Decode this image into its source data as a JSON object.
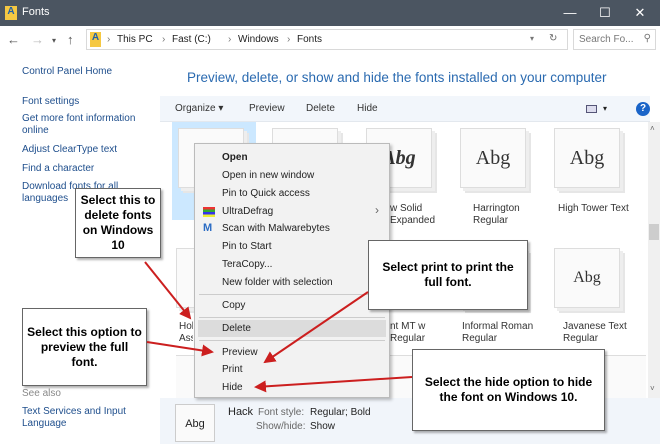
{
  "window": {
    "title": "Fonts",
    "minimize": "—",
    "maximize": "☐",
    "close": "✕"
  },
  "address": {
    "path": [
      "This PC",
      "Fast (C:)",
      "Windows",
      "Fonts"
    ],
    "search_placeholder": "Search Fo..."
  },
  "sidebar": {
    "links": [
      "Control Panel Home",
      "Font settings",
      "Get more font information online",
      "Adjust ClearType text",
      "Find a character",
      "Download fonts for all languages"
    ],
    "see_also": "See also",
    "see_also_links": [
      "Text Services and Input Language"
    ]
  },
  "heading": "Preview, delete, or show and hide the fonts installed on your computer",
  "toolbar": {
    "organize": "Organize ▾",
    "preview": "Preview",
    "delete": "Delete",
    "hide": "Hide",
    "help": "?"
  },
  "fonts": [
    {
      "sample": "",
      "name": ""
    },
    {
      "sample": "",
      "name": ""
    },
    {
      "sample": "Abg",
      "name": "w Solid Expanded"
    },
    {
      "sample": "Abg",
      "name": "Harrington Regular"
    },
    {
      "sample": "Abg",
      "name": "High Tower Text"
    },
    {
      "sample": "",
      "name": "Hol Ass"
    },
    {
      "sample": "",
      "name": "nt MT w Regular"
    },
    {
      "sample": "",
      "name": "Informal Roman Regular"
    },
    {
      "sample": "Abg",
      "name": "Javanese Text Regular"
    }
  ],
  "context_menu": [
    "Open",
    "Open in new window",
    "Pin to Quick access",
    "UltraDefrag",
    "Scan with Malwarebytes",
    "Pin to Start",
    "TeraCopy...",
    "New folder with selection",
    "Copy",
    "Delete",
    "Preview",
    "Print",
    "Hide"
  ],
  "details": {
    "sample": "Abg",
    "name": "Hack",
    "style_label": "Font style:",
    "style_value": "Regular; Bold",
    "showhide_label": "Show/hide:",
    "showhide_value": "Show"
  },
  "callouts": {
    "delete": "Select this to delete fonts on Windows 10",
    "print": "Select print to print the full font.",
    "preview": "Select this option to preview the full font.",
    "hide": "Select the hide option to hide the font on Windows 10."
  },
  "colors": {
    "accent": "#2a6ab0",
    "arrow": "#cc1f1f",
    "selection": "#cce8ff"
  }
}
